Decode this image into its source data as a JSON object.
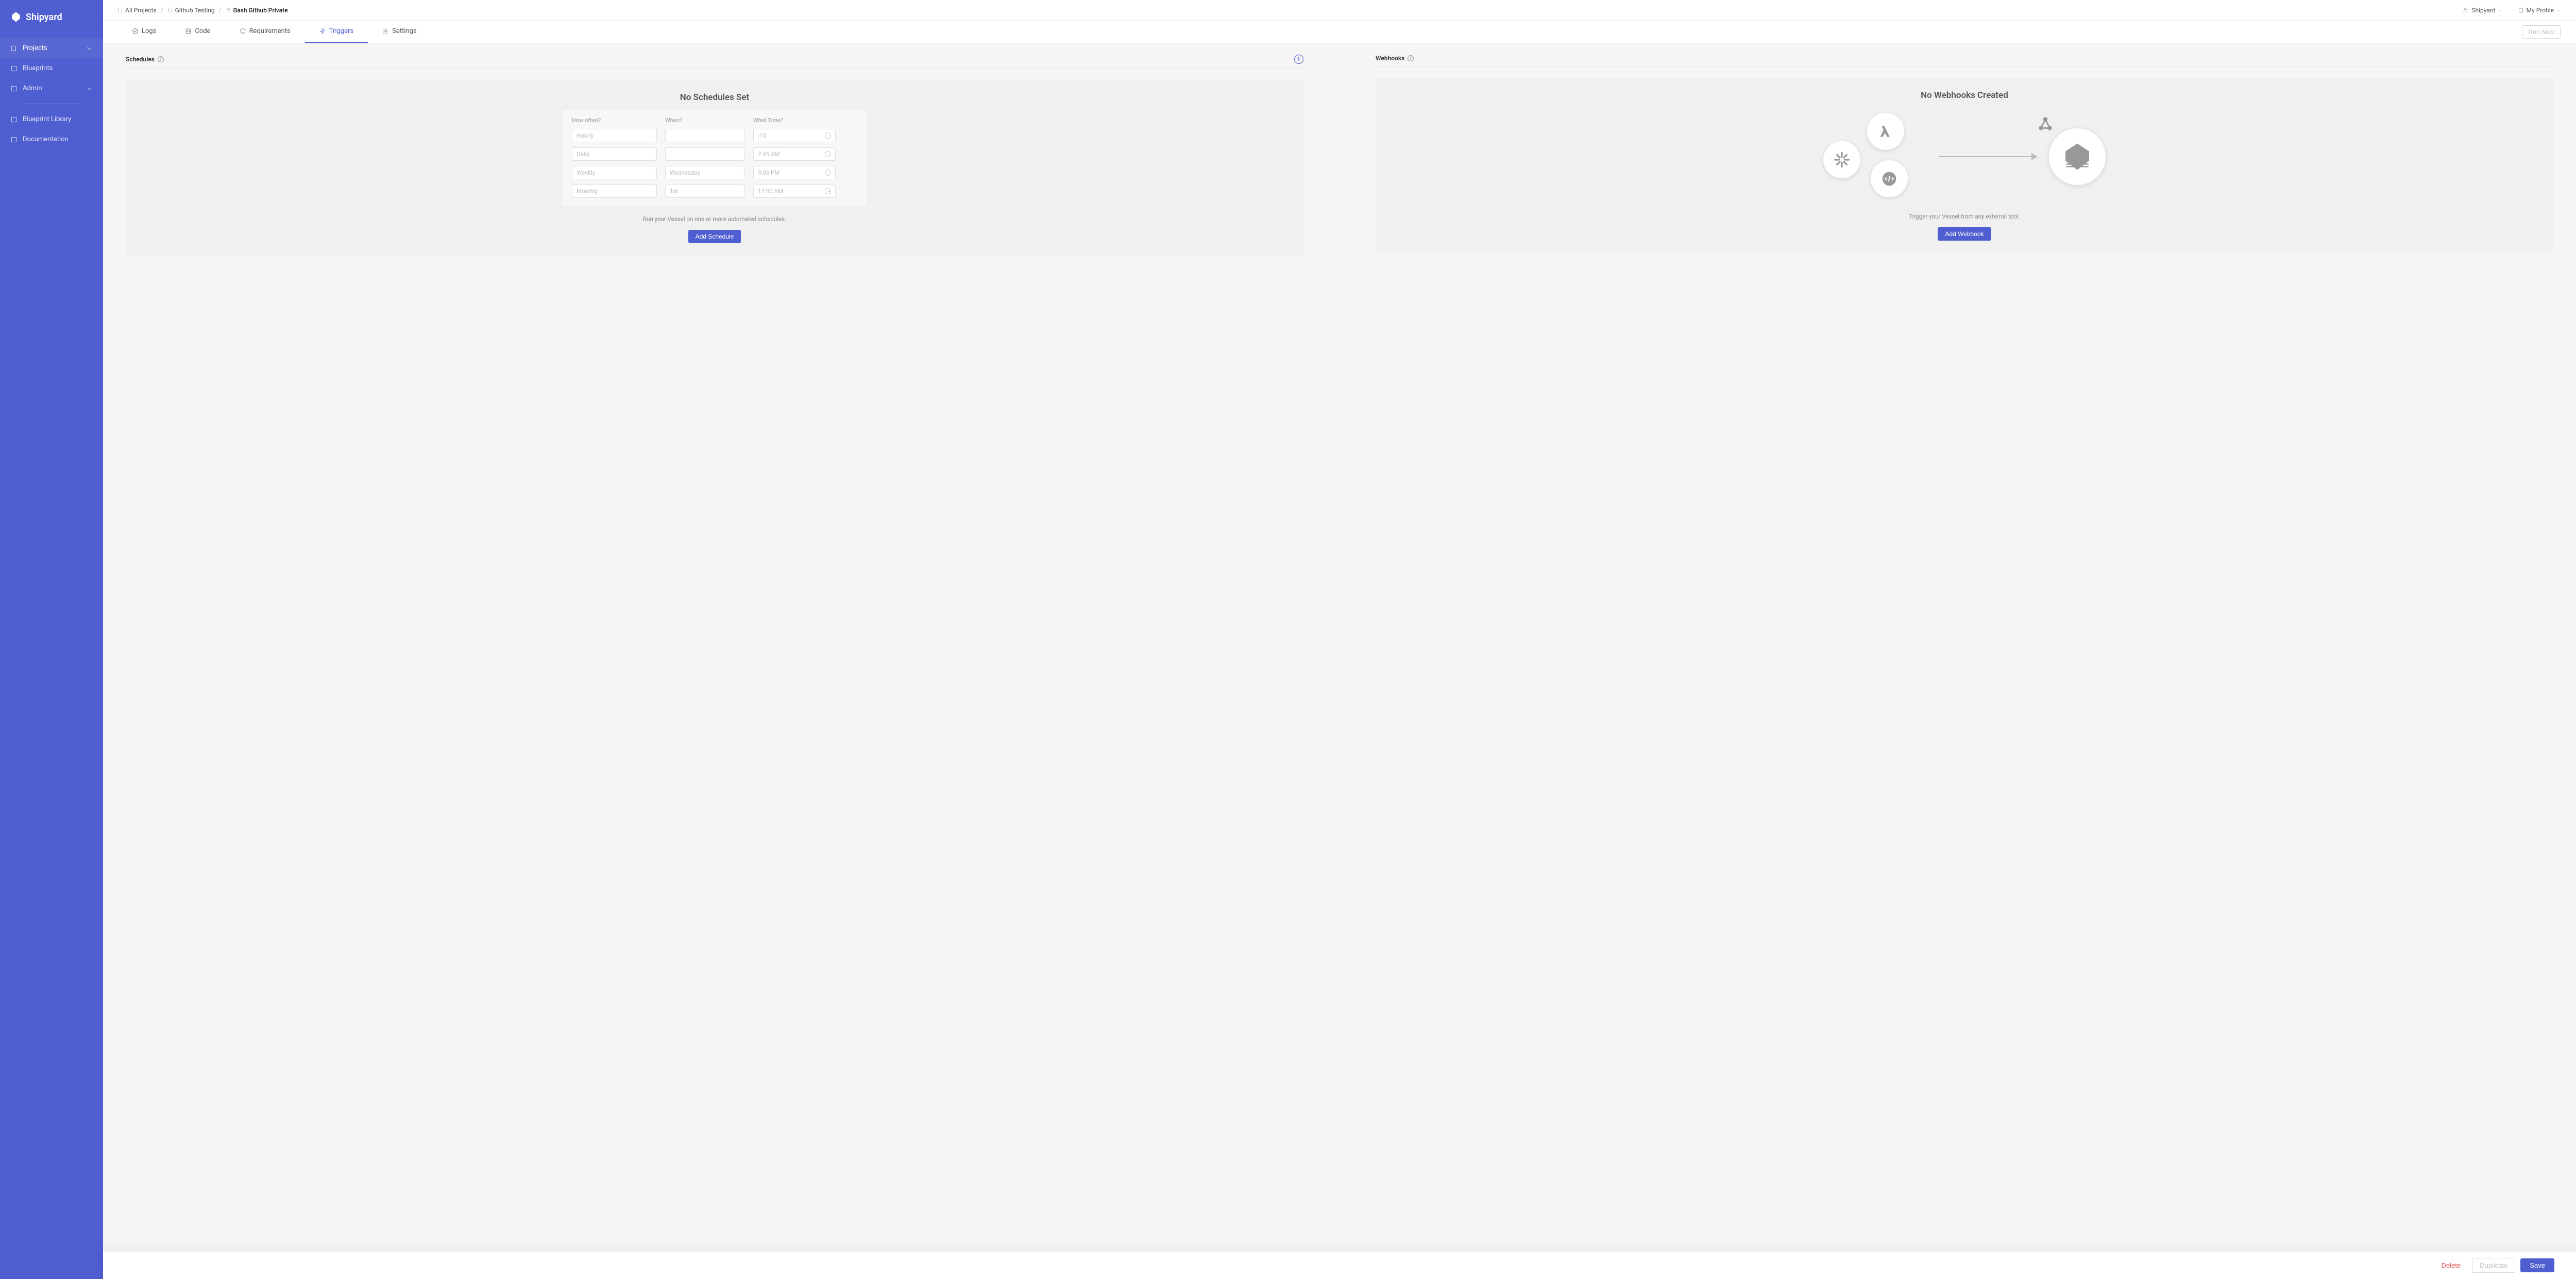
{
  "brand": "Shipyard",
  "sidebar": {
    "items": [
      {
        "label": "Projects",
        "expandable": true,
        "expanded": true
      },
      {
        "label": "Blueprints",
        "expandable": false
      },
      {
        "label": "Admin",
        "expandable": true,
        "expanded": false
      }
    ],
    "secondary": [
      {
        "label": "Blueprint Library"
      },
      {
        "label": "Documentation"
      }
    ]
  },
  "breadcrumbs": {
    "all_projects": "All Projects",
    "project": "Github Testing",
    "current": "Bash Github Private"
  },
  "top_right": {
    "org": "Shipyard",
    "profile": "My Profile"
  },
  "tabs": {
    "logs": "Logs",
    "code": "Code",
    "requirements": "Requirements",
    "triggers": "Triggers",
    "settings": "Settings"
  },
  "run_now": "Run Now",
  "schedules": {
    "header": "Schedules",
    "title": "No Schedules Set",
    "col_how": "How often?",
    "col_when": "When?",
    "col_time": "What Time?",
    "rows": [
      {
        "freq": "Hourly",
        "when": "",
        "time": ":15"
      },
      {
        "freq": "Daily",
        "when": "",
        "time": "7:45 AM"
      },
      {
        "freq": "Weekly",
        "when": "Wednesday",
        "time": "9:05 PM"
      },
      {
        "freq": "Monthly",
        "when": "1st",
        "time": "12:00 AM"
      }
    ],
    "desc": "Run your Vessel on one or more automated schedules.",
    "add_button": "Add Schedule"
  },
  "webhooks": {
    "header": "Webhooks",
    "title": "No Webhooks Created",
    "desc": "Trigger your Vessel from any external tool.",
    "add_button": "Add Webhook"
  },
  "footer": {
    "delete": "Delete",
    "duplicate": "Duplicate",
    "save": "Save"
  }
}
